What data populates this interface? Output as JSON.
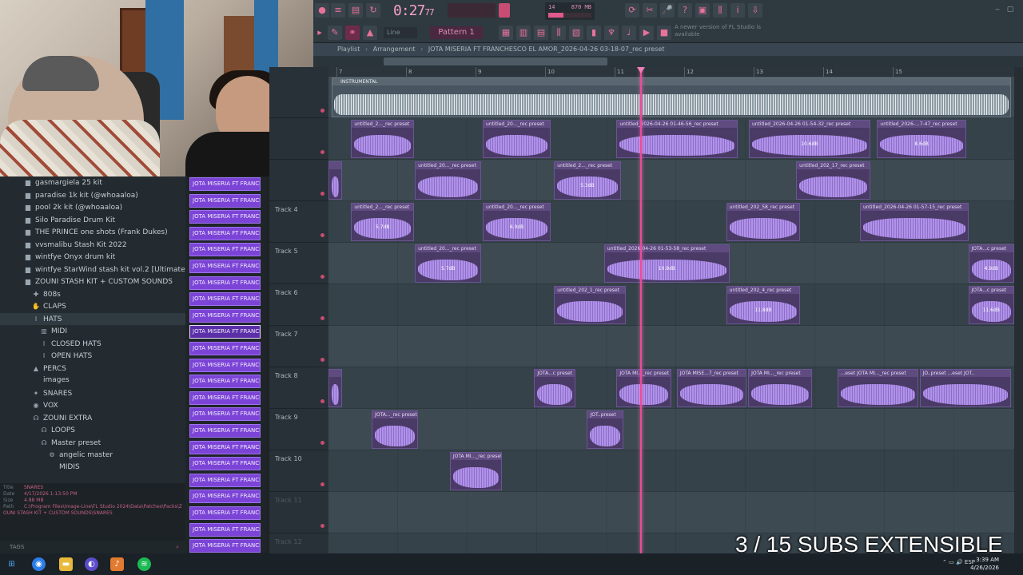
{
  "toolbar": {
    "time": "0:27",
    "time_frac": "77",
    "pattern": "Pattern 1",
    "snap": "Line",
    "cpu_mb": "870 MB",
    "cpu_val": "14",
    "cpu_val2": "6",
    "news": "A newer version of FL Studio is available"
  },
  "playlist": {
    "title": "Playlist",
    "section": "Arrangement",
    "file": "JOTA MISERIA FT FRANCHESCO EL AMOR_2026-04-26 03-18-07_rec preset",
    "ruler": [
      "7",
      "8",
      "9",
      "10",
      "11",
      "12",
      "13",
      "14",
      "15"
    ],
    "instrumental_label": "INSTRUMENTAL"
  },
  "browser": {
    "items": [
      {
        "icon": "folder",
        "label": "gasmargiela 25 kit"
      },
      {
        "icon": "folder",
        "label": "paradise 1k kit (@whoaaloa)"
      },
      {
        "icon": "folder",
        "label": "pool 2k kit (@whoaaloa)"
      },
      {
        "icon": "folder",
        "label": "Silo Paradise Drum Kit"
      },
      {
        "icon": "folder",
        "label": "THE PRINCE one shots (Frank Dukes)"
      },
      {
        "icon": "folder",
        "label": "vvsmalibu Stash Kit 2022"
      },
      {
        "icon": "folder",
        "label": "wintfye Onyx drum kit"
      },
      {
        "icon": "folder",
        "label": "wintfye StarWind stash kit vol.2 [Ultimate]"
      },
      {
        "icon": "folder-open",
        "label": "ZOUNI STASH KIT + CUSTOM SOUNDS"
      },
      {
        "icon": "drum",
        "label": "808s"
      },
      {
        "icon": "clap",
        "label": "CLAPS"
      },
      {
        "icon": "hat",
        "label": "HATS"
      },
      {
        "icon": "midi",
        "label": "MIDI"
      },
      {
        "icon": "hat",
        "label": "CLOSED HATS"
      },
      {
        "icon": "hat",
        "label": "OPEN HATS"
      },
      {
        "icon": "perc",
        "label": "PERCS"
      },
      {
        "icon": "none",
        "label": "images"
      },
      {
        "icon": "snare",
        "label": "SNARES"
      },
      {
        "icon": "vox",
        "label": "VOX"
      },
      {
        "icon": "head",
        "label": "ZOUNI EXTRA"
      },
      {
        "icon": "head",
        "label": "LOOPS"
      },
      {
        "icon": "head",
        "label": "Master preset"
      },
      {
        "icon": "gear",
        "label": "angelic master"
      },
      {
        "icon": "none",
        "label": "MIDIS"
      }
    ],
    "info": {
      "title_k": "Title",
      "title_v": "SNARES",
      "date_k": "Date",
      "date_v": "4/17/2026 1:13:50 PM",
      "size_k": "Size",
      "size_v": "4.88 MB",
      "path_k": "Path",
      "path_v": "C:\\Program Files\\Image-Line\\FL Studio 2024\\Data\\Patches\\Packs\\ZOUNI STASH KIT + CUSTOM SOUNDS\\SNARES"
    },
    "tags": "TAGS"
  },
  "patterns": {
    "label": "JOTA MISERIA FT FRANCH...",
    "count": 23,
    "selected": 9
  },
  "tracks": [
    "",
    "",
    "",
    "Track 4",
    "Track 5",
    "Track 6",
    "Track 7",
    "Track 8",
    "Track 9",
    "Track 10",
    "Track 11",
    "Track 12"
  ],
  "clips": [
    {
      "lane": 1,
      "start": 0.033,
      "end": 0.125,
      "title": "untitled_2..._rec preset",
      "db": ""
    },
    {
      "lane": 1,
      "start": 0.225,
      "end": 0.324,
      "title": "untitled_20..._rec preset",
      "db": ""
    },
    {
      "lane": 1,
      "start": 0.42,
      "end": 0.597,
      "title": "untitled_2026-04-26 01-46-56_rec preset",
      "db": ""
    },
    {
      "lane": 1,
      "start": 0.613,
      "end": 0.79,
      "title": "untitled_2026-04-26 01-54-32_rec preset",
      "db": "10.6dB"
    },
    {
      "lane": 1,
      "start": 0.8,
      "end": 0.93,
      "title": "untitled_2026-...7-47_rec preset",
      "db": "8.6dB"
    },
    {
      "lane": 2,
      "start": 0.0,
      "end": 0.02,
      "title": "",
      "db": ""
    },
    {
      "lane": 2,
      "start": 0.126,
      "end": 0.223,
      "title": "untitled_20..._rec preset",
      "db": ""
    },
    {
      "lane": 2,
      "start": 0.329,
      "end": 0.426,
      "title": "untitled_2..._rec preset",
      "db": "5.3dB"
    },
    {
      "lane": 2,
      "start": 0.682,
      "end": 0.79,
      "title": "untitled_202_17_rec preset",
      "db": ""
    },
    {
      "lane": 3,
      "start": 0.033,
      "end": 0.125,
      "title": "untitled_2..._rec preset",
      "db": "5.7dB"
    },
    {
      "lane": 3,
      "start": 0.225,
      "end": 0.324,
      "title": "untitled_20..._rec preset",
      "db": "6.0dB"
    },
    {
      "lane": 3,
      "start": 0.58,
      "end": 0.688,
      "title": "untitled_202_58_rec preset",
      "db": ""
    },
    {
      "lane": 3,
      "start": 0.775,
      "end": 0.933,
      "title": "untitled_2026-04-26 01-57-15_rec preset",
      "db": ""
    },
    {
      "lane": 4,
      "start": 0.126,
      "end": 0.223,
      "title": "untitled_20..._rec preset",
      "db": "5.7dB"
    },
    {
      "lane": 4,
      "start": 0.402,
      "end": 0.585,
      "title": "untitled_2026-04-26 01-53-58_rec preset",
      "db": "10.9dB"
    },
    {
      "lane": 4,
      "start": 0.933,
      "end": 1.0,
      "title": "JOTA...c preset",
      "db": "4.9dB"
    },
    {
      "lane": 5,
      "start": 0.329,
      "end": 0.433,
      "title": "untitled_202_1_rec preset",
      "db": ""
    },
    {
      "lane": 5,
      "start": 0.58,
      "end": 0.688,
      "title": "untitled_202_4_rec preset",
      "db": "11.8dB"
    },
    {
      "lane": 5,
      "start": 0.933,
      "end": 1.0,
      "title": "JOTA...c preset",
      "db": "11.6dB"
    },
    {
      "lane": 7,
      "start": 0.0,
      "end": 0.02,
      "title": "",
      "db": ""
    },
    {
      "lane": 7,
      "start": 0.3,
      "end": 0.36,
      "title": "JOTA...c preset",
      "db": ""
    },
    {
      "lane": 7,
      "start": 0.42,
      "end": 0.5,
      "title": "JOTA MI..._rec preset",
      "db": ""
    },
    {
      "lane": 7,
      "start": 0.508,
      "end": 0.61,
      "title": "JOTA MISE...7_rec preset",
      "db": ""
    },
    {
      "lane": 7,
      "start": 0.612,
      "end": 0.705,
      "title": "JOTA MI..._rec preset",
      "db": ""
    },
    {
      "lane": 7,
      "start": 0.742,
      "end": 0.86,
      "title": "...eset JOTA MI..._rec preset",
      "db": ""
    },
    {
      "lane": 7,
      "start": 0.862,
      "end": 0.995,
      "title": "JO..preset ...eset JOT..",
      "db": ""
    },
    {
      "lane": 8,
      "start": 0.063,
      "end": 0.13,
      "title": "JOTA..._rec preset",
      "db": ""
    },
    {
      "lane": 8,
      "start": 0.377,
      "end": 0.43,
      "title": "JOT..preset",
      "db": ""
    },
    {
      "lane": 9,
      "start": 0.177,
      "end": 0.253,
      "title": "JOTA MI..._rec preset",
      "db": ""
    }
  ],
  "playhead": 0.4545,
  "overlay_text": "3 / 15 SUBS EXTENSIBLE",
  "taskbar": {
    "lang": "ESP",
    "time": "3:39 AM",
    "date": "4/26/2026"
  }
}
